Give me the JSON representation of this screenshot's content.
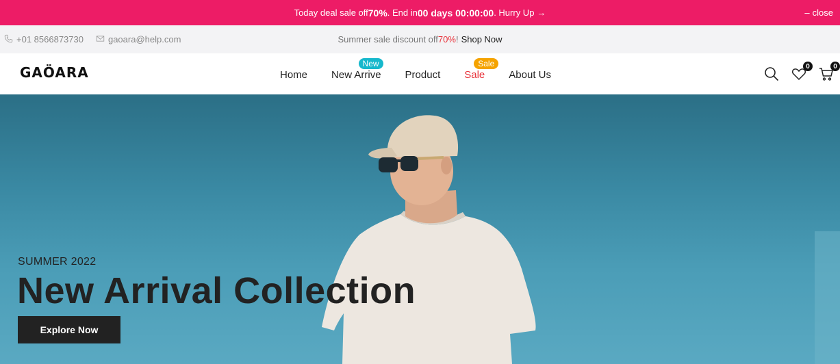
{
  "promo": {
    "text_pre": "Today deal sale off ",
    "discount": "70%",
    "text_mid": " . End in ",
    "countdown": "00 days 00:00:00",
    "text_post": ". Hurry Up",
    "arrow": "→",
    "close_label": "close"
  },
  "info": {
    "phone": "+01 8566873730",
    "email": "gaoara@help.com",
    "sale_text": "Summer sale discount off ",
    "sale_pct": "70%",
    "sale_bang": "!",
    "shop_now": "Shop Now"
  },
  "header": {
    "logo": "GAÖARA",
    "nav": [
      {
        "label": "Home"
      },
      {
        "label": "New Arrive",
        "badge": "New"
      },
      {
        "label": "Product"
      },
      {
        "label": "Sale",
        "badge": "Sale"
      },
      {
        "label": "About Us"
      }
    ],
    "wishlist_count": "0",
    "cart_count": "0"
  },
  "hero": {
    "subtitle": "SUMMER 2022",
    "title": "New Arrival Collection",
    "button": "Explore Now"
  },
  "colors": {
    "promo_bg": "#ed1c66",
    "accent_red": "#e8323a",
    "badge_new": "#16b8cc",
    "badge_sale": "#f5a300",
    "hero_sky": "#3a89a3"
  },
  "icons": [
    "phone-icon",
    "mail-icon",
    "search-icon",
    "heart-icon",
    "cart-icon"
  ]
}
